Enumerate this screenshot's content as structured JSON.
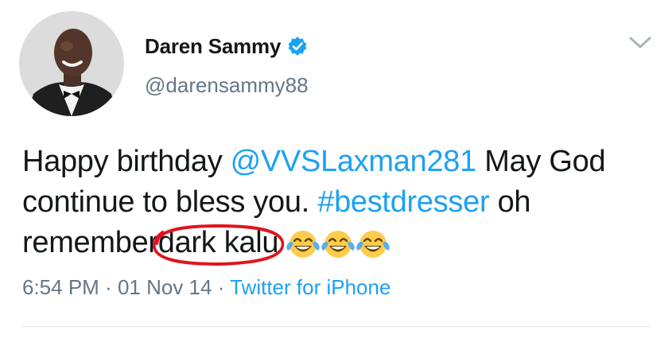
{
  "user": {
    "display_name": "Daren Sammy",
    "handle": "@darensammy88",
    "verified": true
  },
  "tweet": {
    "part1": "Happy birthday ",
    "mention": "@VVSLaxman281",
    "part2": " May God continue to bless you. ",
    "hashtag": "#bestdresser",
    "part3": " oh remember",
    "circled_text": "dark kalu",
    "emoji_count": 3,
    "emoji_name": "face-with-tears-of-joy-icon"
  },
  "meta": {
    "time": "6:54 PM",
    "sep1": " · ",
    "date": "01 Nov 14",
    "sep2": " · ",
    "source": "Twitter for iPhone"
  },
  "colors": {
    "link": "#1da1f2",
    "text": "#14171a",
    "muted": "#657786",
    "annotation": "#e0141e"
  },
  "icons": {
    "verified": "verified-badge-icon",
    "more": "chevron-down-icon"
  }
}
